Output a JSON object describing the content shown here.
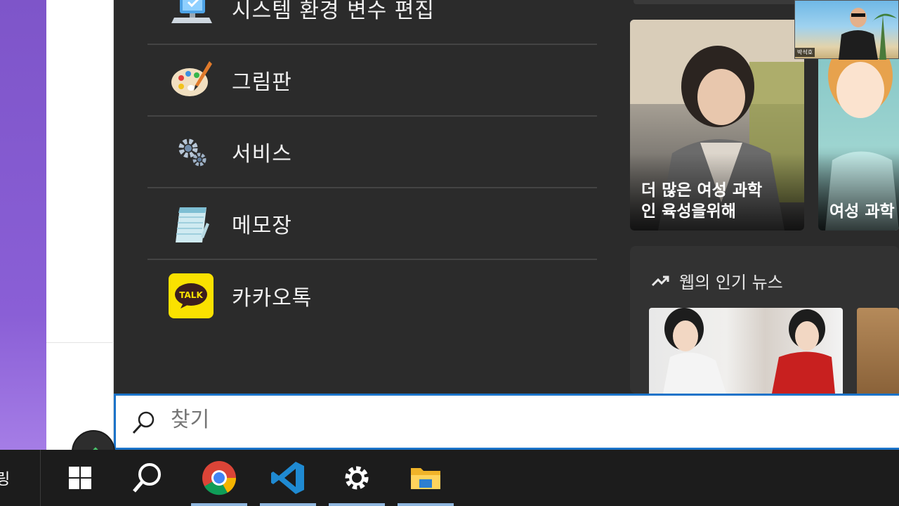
{
  "results": [
    {
      "label": "시스템 환경 변수 편집",
      "icon": "system-settings-icon"
    },
    {
      "label": "그림판",
      "icon": "paint-palette-icon"
    },
    {
      "label": "서비스",
      "icon": "gears-icon"
    },
    {
      "label": "메모장",
      "icon": "notepad-icon"
    },
    {
      "label": "카카오톡",
      "icon": "kakaotalk-icon",
      "icon_text": "TALK"
    }
  ],
  "news": {
    "cards": [
      {
        "title": "더 많은 여성 과학\n인 육성을위해"
      },
      {
        "title": "여성 과학\n비는 절반"
      }
    ],
    "trending": {
      "label": "웹의 인기 뉴스"
    }
  },
  "search": {
    "placeholder": "찾기"
  },
  "video_overlay": {
    "name": "박석호"
  },
  "taskbar": {
    "left_char": "링",
    "apps": [
      "windows-start-icon",
      "search-icon",
      "chrome-icon",
      "vscode-icon",
      "settings-icon",
      "file-explorer-icon"
    ]
  },
  "colors": {
    "accent": "#1b73c9",
    "panel": "#2b2b2b",
    "taskbar": "#1c1c1c",
    "kakao": "#fae100"
  }
}
